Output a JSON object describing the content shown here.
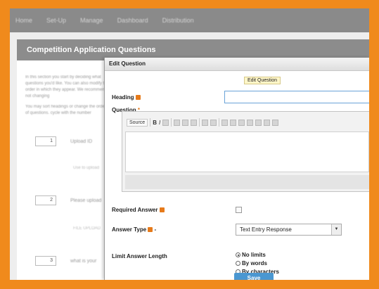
{
  "topnav": {
    "items": [
      "Home",
      "Set-Up",
      "Manage",
      "Dashboard",
      "Distribution"
    ]
  },
  "background": {
    "title": "Competition Application Questions",
    "intro_1": "In this section you start by deciding what questions you'd like. You can also modify the order in which they appear. We recommend not changing",
    "intro_2": "You may sort headings or change the order of questions. cycle with the number",
    "questions": [
      {
        "num": "1",
        "text": "Upload ID",
        "sub": "Use to upload"
      },
      {
        "num": "2",
        "text": "Please upload",
        "sub": "FILE UPLOAD"
      },
      {
        "num": "3",
        "text": "what is your"
      }
    ]
  },
  "modal": {
    "title": "Edit Question",
    "tooltip": "Edit Question",
    "heading_label": "Heading",
    "heading_value": "",
    "question_label": "Question",
    "question_required_mark": "*",
    "toolbar_source": "Source",
    "toolbar_bold": "B",
    "toolbar_italic": "I",
    "required_answer_label": "Required Answer",
    "answer_type_label": "Answer Type",
    "answer_type_suffix": "-",
    "answer_type_value": "Text Entry Response",
    "limit_label": "Limit Answer Length",
    "limit_options": [
      "No limits",
      "By words",
      "By characters"
    ],
    "limit_selected_index": 0,
    "save_label": "Save"
  }
}
